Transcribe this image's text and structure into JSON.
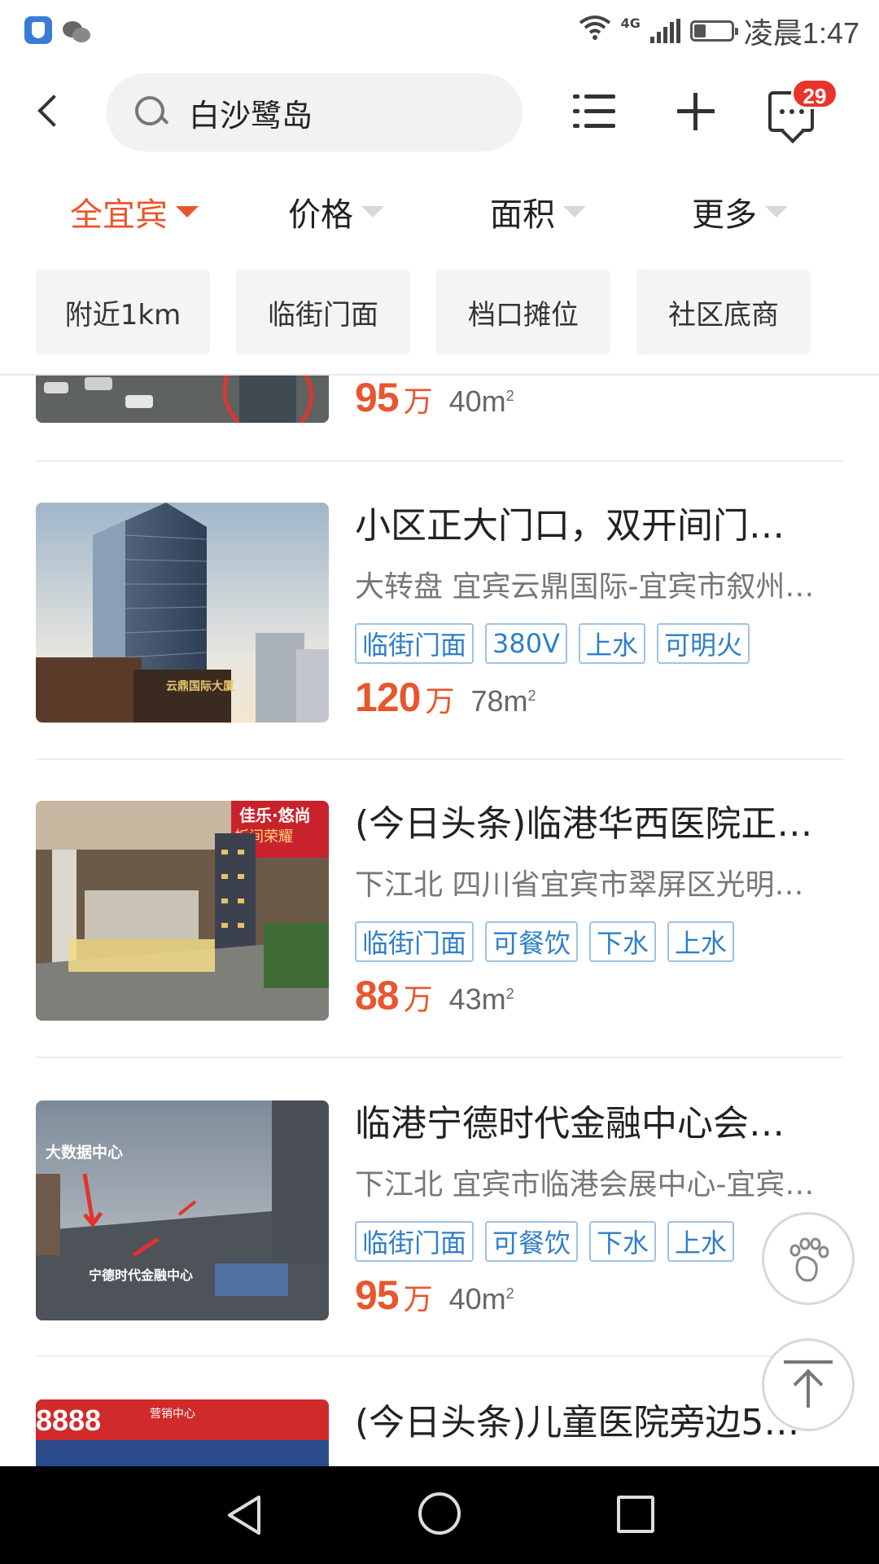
{
  "status_bar": {
    "network": "4G",
    "time": "凌晨1:47",
    "icons": [
      "security-app-icon",
      "wechat-icon",
      "wifi-icon",
      "signal-icon",
      "battery-icon"
    ]
  },
  "header": {
    "search_text": "白沙鹭岛",
    "message_badge": "29",
    "icons": [
      "back-icon",
      "search-icon",
      "list-icon",
      "plus-icon",
      "message-icon"
    ]
  },
  "filters": [
    {
      "label": "全宜宾",
      "active": true
    },
    {
      "label": "价格",
      "active": false
    },
    {
      "label": "面积",
      "active": false
    },
    {
      "label": "更多",
      "active": false
    }
  ],
  "chips": [
    "附近1km",
    "临街门面",
    "档口摊位",
    "社区底商"
  ],
  "listings": [
    {
      "title": "",
      "address": "",
      "tags": [],
      "price": "95",
      "price_unit": "万",
      "area": "40m",
      "area_sup": "2"
    },
    {
      "title": "小区正大门口，双开间门…",
      "address": "大转盘 宜宾云鼎国际-宜宾市叙州…",
      "tags": [
        "临街门面",
        "380V",
        "上水",
        "可明火"
      ],
      "price": "120",
      "price_unit": "万",
      "area": "78m",
      "area_sup": "2"
    },
    {
      "title": "(今日头条)临港华西医院正…",
      "address": "下江北 四川省宜宾市翠屏区光明…",
      "tags": [
        "临街门面",
        "可餐饮",
        "下水",
        "上水"
      ],
      "price": "88",
      "price_unit": "万",
      "area": "43m",
      "area_sup": "2"
    },
    {
      "title": "临港宁德时代金融中心会…",
      "address": "下江北 宜宾市临港会展中心-宜宾…",
      "tags": [
        "临街门面",
        "可餐饮",
        "下水",
        "上水"
      ],
      "price": "95",
      "price_unit": "万",
      "area": "40m",
      "area_sup": "2"
    },
    {
      "title": "(今日头条)儿童医院旁边5…",
      "address": "",
      "tags": [],
      "price": "",
      "price_unit": "",
      "area": "",
      "area_sup": ""
    }
  ],
  "image_text": {
    "building_sign": "云鼎国际大厦",
    "billboard": "佳乐·悠尚",
    "billboard2": "板间荣耀",
    "big_data": "大数据中心",
    "ningde": "宁德时代金融中心",
    "sign_5888": "8888",
    "sign_hall": "营销中心"
  },
  "float_buttons": [
    "footprint-icon",
    "back-to-top-icon"
  ],
  "nav": [
    "nav-back-icon",
    "nav-home-icon",
    "nav-recent-icon"
  ],
  "colors": {
    "accent": "#e8562e",
    "tag_blue": "#2f7fc8",
    "badge_red": "#e8352b"
  }
}
